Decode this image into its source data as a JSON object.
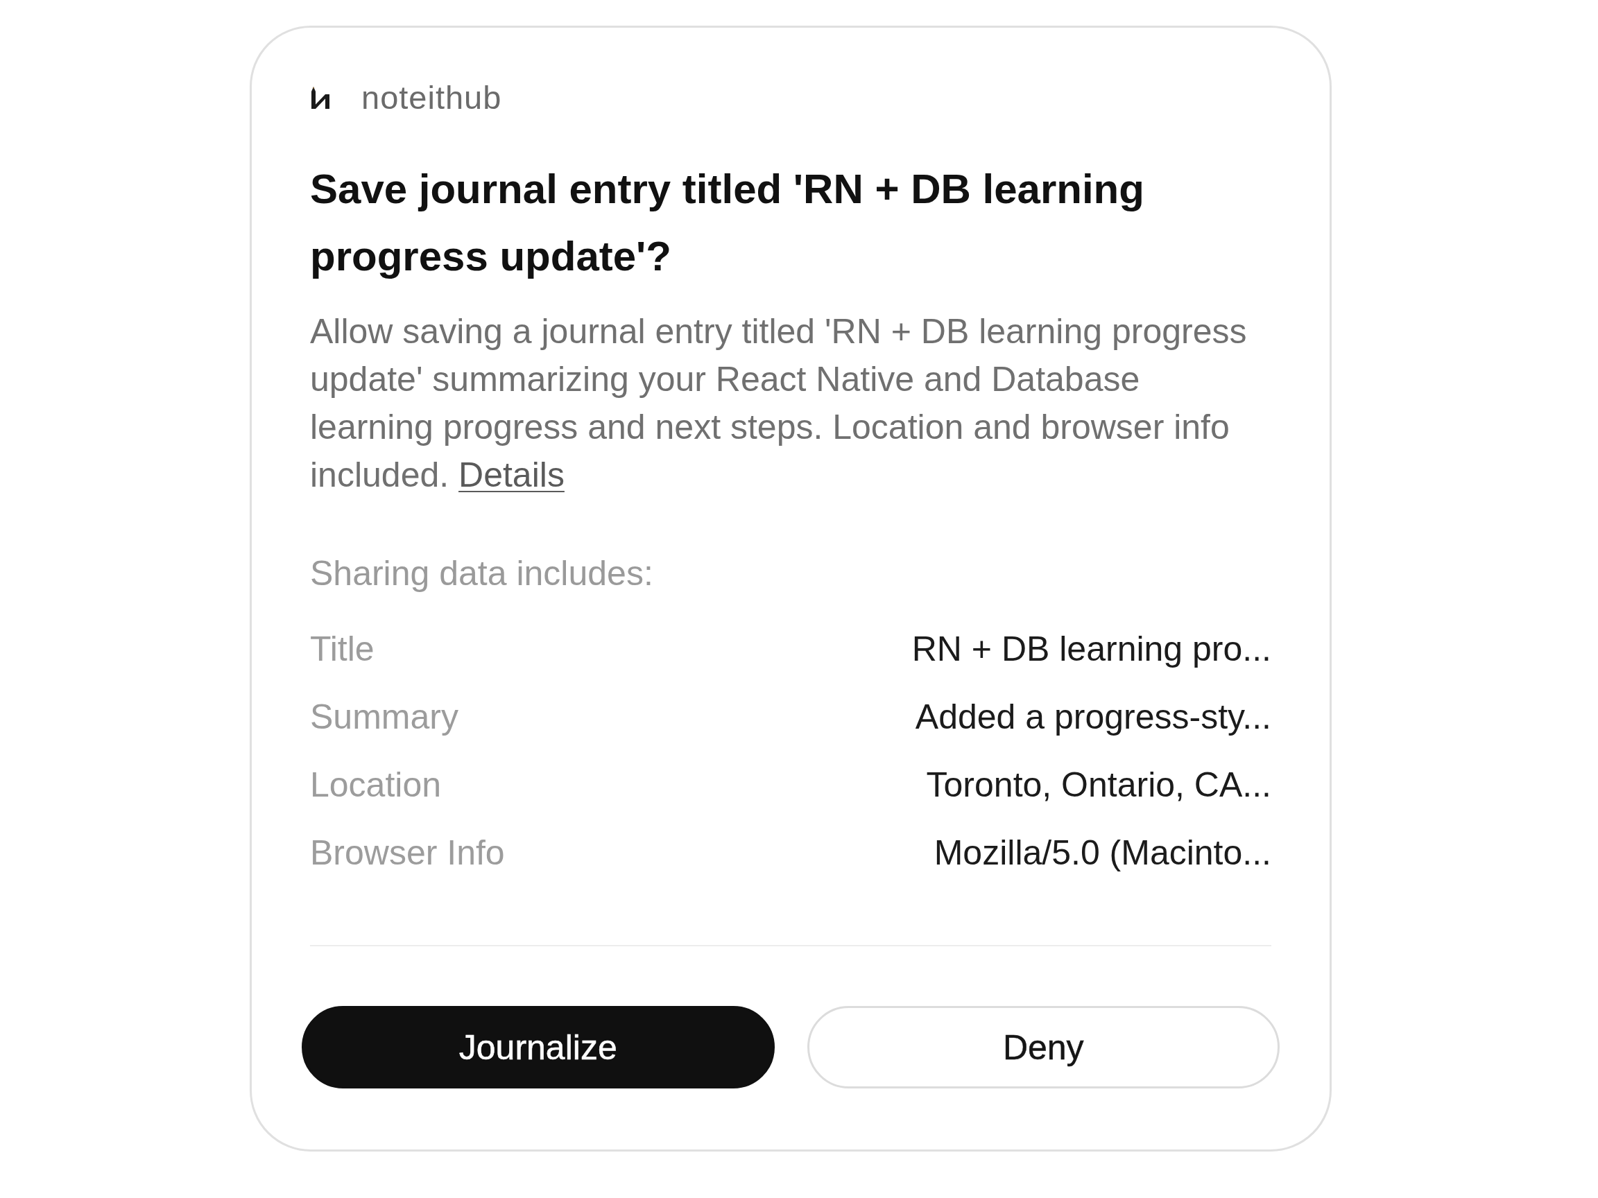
{
  "app": {
    "name": "noteithub"
  },
  "dialog": {
    "title": "Save journal entry titled 'RN + DB learning progress update'?",
    "description": "Allow saving a journal entry titled 'RN + DB learning progress update' summarizing your React Native and Database learning progress and next steps. Location and browser info included.",
    "details_link": "Details",
    "sharing_heading": "Sharing data includes:",
    "sharing_data": [
      {
        "label": "Title",
        "value": "RN + DB learning pro..."
      },
      {
        "label": "Summary",
        "value": "Added a progress-sty..."
      },
      {
        "label": "Location",
        "value": "Toronto, Ontario, CA..."
      },
      {
        "label": "Browser Info",
        "value": "Mozilla/5.0 (Macinto..."
      }
    ],
    "buttons": [
      {
        "label": "Journalize",
        "kind": "primary"
      },
      {
        "label": "Deny",
        "kind": "secondary"
      }
    ]
  }
}
